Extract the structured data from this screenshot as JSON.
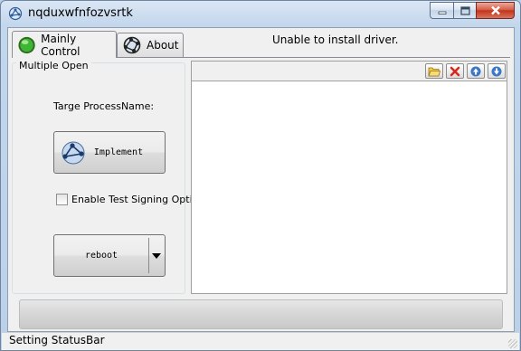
{
  "window": {
    "title": "nqduxwfnfozvsrtk"
  },
  "tabs": [
    {
      "label": "Mainly Control",
      "icon": "green-circle-icon",
      "selected": true
    },
    {
      "label": "About",
      "icon": "network-globe-icon",
      "selected": false
    }
  ],
  "main": {
    "status_message": "Unable to install driver.",
    "group_title": "Multiple Open",
    "target_label": "Targe ProcessName:",
    "implement_label": "Implement",
    "test_signing_label": "Enable Test Signing Option",
    "test_signing_checked": false,
    "reboot_label": "reboot"
  },
  "list_toolbar": {
    "buttons": [
      {
        "icon": "open-folder-icon"
      },
      {
        "icon": "delete-icon"
      },
      {
        "icon": "move-up-icon"
      },
      {
        "icon": "move-down-icon"
      }
    ]
  },
  "statusbar": {
    "text": "Setting StatusBar"
  },
  "colors": {
    "title_bar": "#c2d6ec",
    "close_button": "#c5341b",
    "client_bg": "#f0f0f0"
  }
}
